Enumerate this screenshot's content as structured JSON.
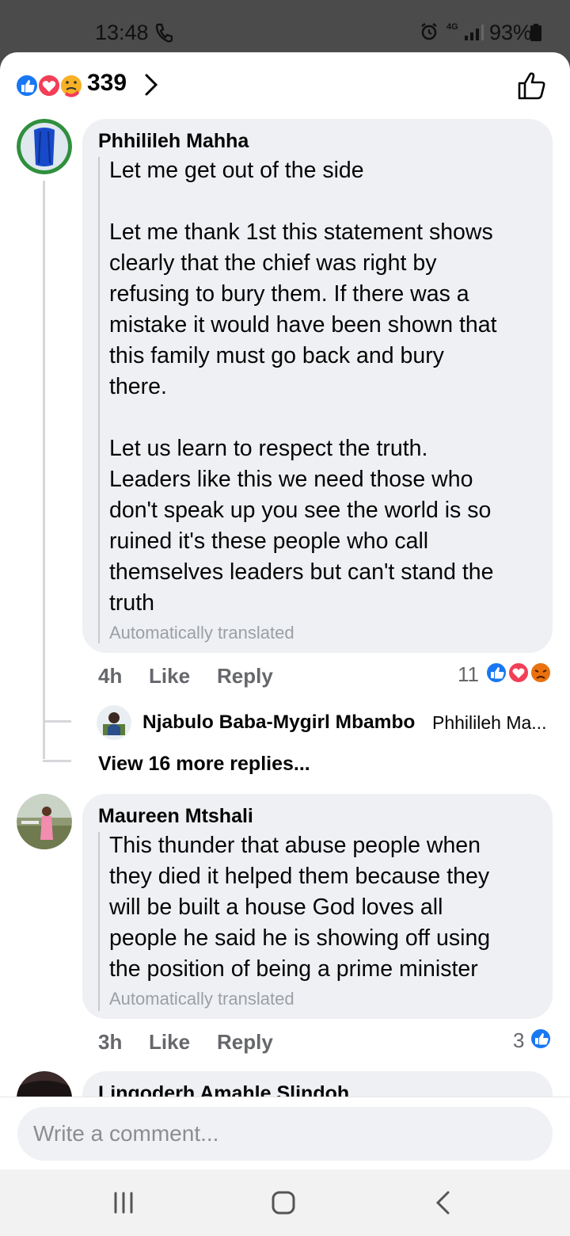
{
  "status_bar": {
    "time": "13:48",
    "network": "4G",
    "battery": "93%",
    "icons": [
      "call-icon",
      "alarm-icon",
      "signal-icon",
      "battery-icon"
    ]
  },
  "reactions_bar": {
    "count": "339",
    "icons": [
      "like-reaction-icon",
      "love-reaction-icon",
      "care-reaction-icon"
    ]
  },
  "comments": [
    {
      "author": "Phhilileh Mahha",
      "paragraphs": [
        [
          "Let me get out of the side"
        ],
        [
          "Let me thank 1st this statement shows",
          "clearly that the chief was right by",
          "refusing to bury them. If there was a",
          "mistake it would have been shown that",
          "this family must go back and bury",
          "there."
        ],
        [
          "Let us learn to respect the truth.",
          "Leaders like this we need those who",
          "don't speak up you see the world is so",
          "ruined it's these people who call",
          "themselves leaders but can't stand the",
          "truth"
        ]
      ],
      "translated_note": "Automatically translated",
      "time": "4h",
      "like_label": "Like",
      "reply_label": "Reply",
      "reaction_count": "11",
      "reaction_icons": [
        "like-reaction-icon",
        "love-reaction-icon",
        "angry-reaction-icon"
      ],
      "reply_preview": {
        "author": "Njabulo Baba-Mygirl Mbambo",
        "text": "Phhilileh Ma..."
      },
      "more_replies": "View 16 more replies..."
    },
    {
      "author": "Maureen Mtshali",
      "paragraphs": [
        [
          "This thunder that abuse people when",
          "they died it helped them because they",
          "will be built a house God loves all",
          "people he said he is showing off using",
          "the position of being a prime minister"
        ]
      ],
      "translated_note": "Automatically translated",
      "time": "3h",
      "like_label": "Like",
      "reply_label": "Reply",
      "reaction_count": "3",
      "reaction_icons": [
        "like-reaction-icon"
      ]
    },
    {
      "author": "Lingoderh Amahle Slindoh"
    }
  ],
  "composer": {
    "placeholder": "Write a comment..."
  },
  "nav_bar": {
    "buttons": [
      "recent-apps-icon",
      "home-icon",
      "back-icon"
    ]
  },
  "colors": {
    "like_blue": "#1877f2",
    "love_red": "#f33e58",
    "care_yellow": "#f7b125",
    "angry_orange": "#e9710f",
    "bubble_bg": "#eff0f3"
  }
}
